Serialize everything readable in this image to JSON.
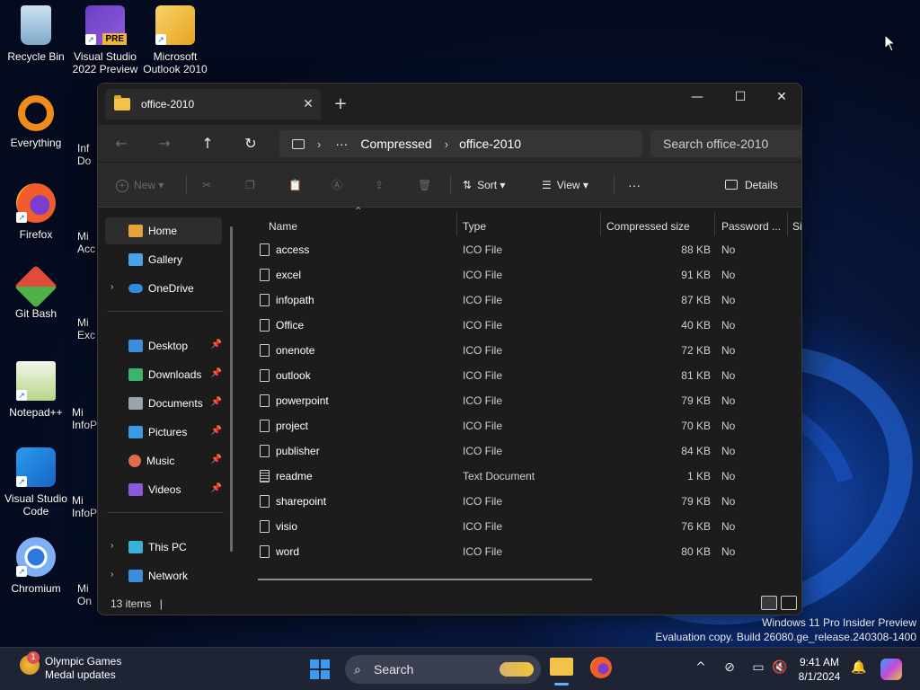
{
  "desktop": {
    "icons": [
      {
        "label": "Recycle Bin"
      },
      {
        "label": "Visual Studio 2022 Preview",
        "badge": "PRE"
      },
      {
        "label": "Microsoft Outlook 2010"
      },
      {
        "label": "Everything"
      },
      {
        "label": "Firefox"
      },
      {
        "label": "Git Bash"
      },
      {
        "label": "Notepad++"
      },
      {
        "label": "Visual Studio Code"
      },
      {
        "label": "Chromium"
      }
    ],
    "partial_icons": [
      "Inf Do",
      "Mi Acc",
      "Mi Exc",
      "Mi InfoP",
      "Mi InfoP",
      "Mi On"
    ]
  },
  "watermark": {
    "line1": "Windows 11 Pro Insider Preview",
    "line2": "Evaluation copy. Build 26080.ge_release.240308-1400"
  },
  "explorer": {
    "tab_title": "office-2010",
    "tab_close": "✕",
    "new_tab": "+",
    "window_controls": {
      "minimize": "—",
      "maximize": "☐",
      "close": "✕"
    },
    "nav": {
      "back": "←",
      "forward": "→",
      "up": "↑",
      "refresh": "↻"
    },
    "address": {
      "more": "···",
      "crumbs": [
        "Compressed",
        "office-2010"
      ],
      "separator": "›"
    },
    "search_placeholder": "Search office-2010",
    "toolbar": {
      "new_label": "New",
      "sort_label": "Sort",
      "view_label": "View",
      "more_label": "···",
      "details_label": "Details"
    },
    "sidebar": {
      "items": [
        {
          "label": "Home",
          "color": "#e8a23c"
        },
        {
          "label": "Gallery",
          "color": "#4aa3e8"
        },
        {
          "label": "OneDrive",
          "color": "#2f8be0"
        },
        {
          "label": "Desktop",
          "color": "#3b8fd9"
        },
        {
          "label": "Downloads",
          "color": "#3cb56b"
        },
        {
          "label": "Documents",
          "color": "#9aa3ad"
        },
        {
          "label": "Pictures",
          "color": "#3b9be0"
        },
        {
          "label": "Music",
          "color": "#e06a4a"
        },
        {
          "label": "Videos",
          "color": "#8a5ad9"
        },
        {
          "label": "This PC",
          "color": "#3bb0d9"
        },
        {
          "label": "Network",
          "color": "#3b8fd9"
        }
      ]
    },
    "columns": {
      "name": "Name",
      "type": "Type",
      "size": "Compressed size",
      "password": "Password ...",
      "extra": "Si"
    },
    "files": [
      {
        "name": "access",
        "type": "ICO File",
        "size": "88 KB",
        "password": "No"
      },
      {
        "name": "excel",
        "type": "ICO File",
        "size": "91 KB",
        "password": "No"
      },
      {
        "name": "infopath",
        "type": "ICO File",
        "size": "87 KB",
        "password": "No"
      },
      {
        "name": "Office",
        "type": "ICO File",
        "size": "40 KB",
        "password": "No"
      },
      {
        "name": "onenote",
        "type": "ICO File",
        "size": "72 KB",
        "password": "No"
      },
      {
        "name": "outlook",
        "type": "ICO File",
        "size": "81 KB",
        "password": "No"
      },
      {
        "name": "powerpoint",
        "type": "ICO File",
        "size": "79 KB",
        "password": "No"
      },
      {
        "name": "project",
        "type": "ICO File",
        "size": "70 KB",
        "password": "No"
      },
      {
        "name": "publisher",
        "type": "ICO File",
        "size": "84 KB",
        "password": "No"
      },
      {
        "name": "readme",
        "type": "Text Document",
        "size": "1 KB",
        "password": "No"
      },
      {
        "name": "sharepoint",
        "type": "ICO File",
        "size": "79 KB",
        "password": "No"
      },
      {
        "name": "visio",
        "type": "ICO File",
        "size": "76 KB",
        "password": "No"
      },
      {
        "name": "word",
        "type": "ICO File",
        "size": "80 KB",
        "password": "No"
      }
    ],
    "status": {
      "count": "13 items",
      "caret": "|"
    }
  },
  "taskbar": {
    "news_title": "Olympic Games",
    "news_sub": "Medal updates",
    "news_badge": "1",
    "search_label": "Search",
    "time": "9:41 AM",
    "date": "8/1/2024",
    "tray_up": "^"
  }
}
